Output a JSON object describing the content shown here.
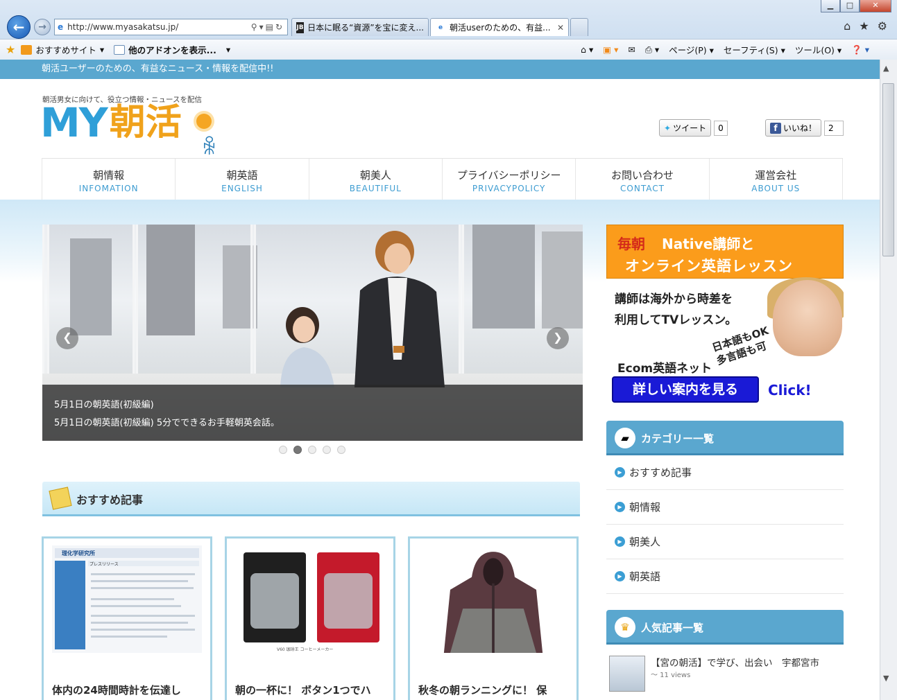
{
  "browser": {
    "window_controls": {
      "minimize": "▁",
      "maximize": "□",
      "close": "✕"
    },
    "address": "http://www.myasakatsu.jp/",
    "tabs": [
      {
        "label": "日本に眠る“資源”を宝に変え...",
        "favicon": "JB"
      },
      {
        "label": "朝活userのための、有益...",
        "favicon": "e",
        "close": "✕"
      }
    ],
    "favorites": {
      "recommended": "おすすめサイト",
      "addons": "他のアドオンを表示..."
    },
    "command_bar": {
      "page": "ページ(P)",
      "safety": "セーフティ(S)",
      "tools": "ツール(O)"
    }
  },
  "site": {
    "topbar": "朝活ユーザーのための、有益なニュース・情報を配信中!!",
    "tagline": "朝活男女に向けて、役立つ情報・ニュースを配信",
    "logo": {
      "my": "MY",
      "asakatsu": "朝活"
    },
    "share": {
      "tweet": "ツイート",
      "tweet_count": "0",
      "like": "いいね！",
      "like_count": "2"
    },
    "nav": [
      {
        "jp": "朝情報",
        "en": "INFOMATION"
      },
      {
        "jp": "朝英語",
        "en": "ENGLISH"
      },
      {
        "jp": "朝美人",
        "en": "BEAUTIFUL"
      },
      {
        "jp": "プライバシーポリシー",
        "en": "PRIVACYPOLICY"
      },
      {
        "jp": "お問い合わせ",
        "en": "CONTACT"
      },
      {
        "jp": "運営会社",
        "en": "ABOUT US"
      }
    ],
    "slider": {
      "title": "5月1日の朝英語(初級編)",
      "description": "5月1日の朝英語(初級編) 5分でできるお手軽朝英会話。",
      "slides": 5,
      "active": 2
    },
    "section_recommended": "おすすめ記事",
    "cards": [
      {
        "title": "体内の24時間時計を伝達し"
      },
      {
        "title": "朝の一杯に！ ボタン1つでハ"
      },
      {
        "title": "秋冬の朝ランニングに！ 保"
      }
    ],
    "card_images": {
      "site_name": "理化学研究所",
      "press": "プレスリリース",
      "coffee": "V60 珈琲王 コーヒーメーカー"
    },
    "ad": {
      "maiasa": "毎朝",
      "line1": "Native講師と",
      "line2": "オンライン英語レッスン",
      "body1": "講師は海外から時差を",
      "body2": "利用してTVレッスン。",
      "tilt1": "日本語もOK",
      "tilt2": "多言語も可",
      "brand": "Ecom英語ネット",
      "cta": "詳しい案内を見る",
      "click": "Click!"
    },
    "category_title": "カテゴリー一覧",
    "categories": [
      "おすすめ記事",
      "朝情報",
      "朝美人",
      "朝英語"
    ],
    "popular_title": "人気記事一覧",
    "popular": [
      {
        "title": "【宮の朝活】で学び、出会い　宇都宮市",
        "views": "～ 11 views"
      }
    ]
  },
  "colors": {
    "accent_blue": "#5aa7cf",
    "logo_blue": "#2f9fd8",
    "logo_orange": "#f0a21b",
    "ad_orange": "#fb9c1b"
  }
}
